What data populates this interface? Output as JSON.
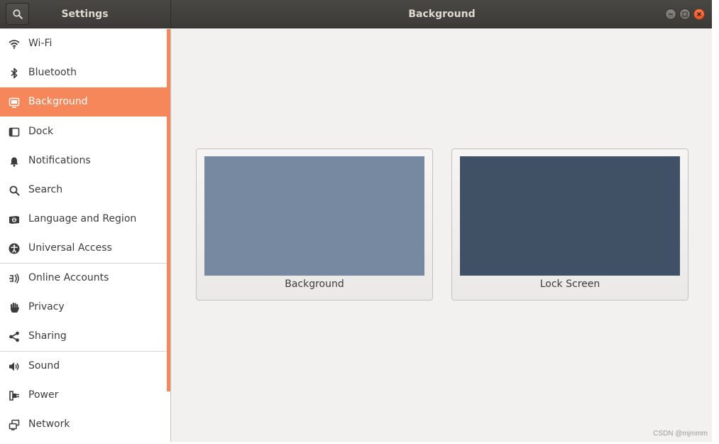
{
  "header": {
    "left_title": "Settings",
    "main_title": "Background"
  },
  "sidebar": {
    "items": [
      {
        "label": "Wi-Fi",
        "icon": "wifi-icon"
      },
      {
        "label": "Bluetooth",
        "icon": "bluetooth-icon"
      },
      {
        "label": "Background",
        "icon": "background-icon",
        "selected": true
      },
      {
        "label": "Dock",
        "icon": "dock-icon"
      },
      {
        "label": "Notifications",
        "icon": "bell-icon"
      },
      {
        "label": "Search",
        "icon": "search-icon"
      },
      {
        "label": "Language and Region",
        "icon": "language-icon"
      },
      {
        "label": "Universal Access",
        "icon": "accessibility-icon"
      },
      {
        "label": "Online Accounts",
        "icon": "online-accounts-icon"
      },
      {
        "label": "Privacy",
        "icon": "hand-icon"
      },
      {
        "label": "Sharing",
        "icon": "share-icon"
      },
      {
        "label": "Sound",
        "icon": "speaker-icon"
      },
      {
        "label": "Power",
        "icon": "power-plug-icon"
      },
      {
        "label": "Network",
        "icon": "network-icon"
      }
    ]
  },
  "main": {
    "cards": [
      {
        "caption": "Background",
        "color": "#7788a1"
      },
      {
        "caption": "Lock Screen",
        "color": "#415165"
      }
    ]
  },
  "colors": {
    "accent": "#f5875a",
    "header": "#3b3a36",
    "window_bg": "#f2f1f0"
  },
  "watermark": "CSDN @mjmmm"
}
